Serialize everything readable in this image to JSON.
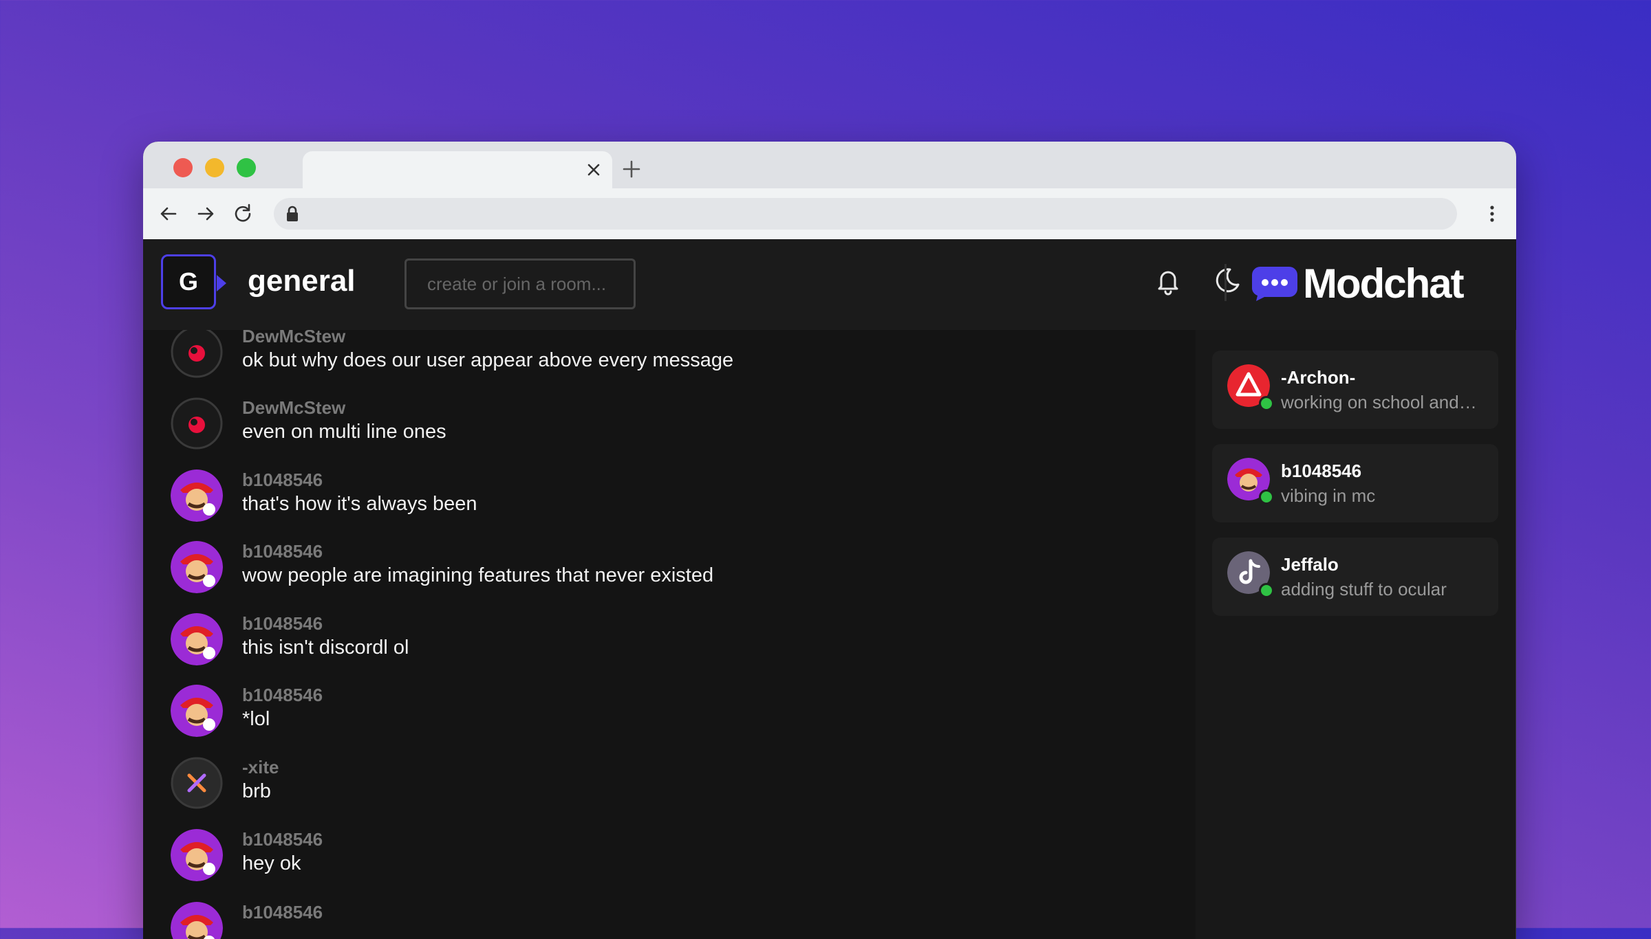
{
  "browser": {
    "tab_title": "",
    "url": ""
  },
  "header": {
    "room_initial": "G",
    "room_name": "general",
    "room_input_placeholder": "create or join a room...",
    "brand_name": "Modchat"
  },
  "messages": [
    {
      "author": "DewMcStew",
      "text": "ok but why does our user appear above every message",
      "avatar": "dewmcstew-avatar"
    },
    {
      "author": "DewMcStew",
      "text": "even on multi line ones",
      "avatar": "dewmcstew-avatar"
    },
    {
      "author": "b1048546",
      "text": "that's how it's always been",
      "avatar": "mario-avatar"
    },
    {
      "author": "b1048546",
      "text": "wow people are imagining features that never existed",
      "avatar": "mario-avatar"
    },
    {
      "author": "b1048546",
      "text": "this isn't discordl ol",
      "avatar": "mario-avatar"
    },
    {
      "author": "b1048546",
      "text": "*lol",
      "avatar": "mario-avatar"
    },
    {
      "author": "-xite",
      "text": "brb",
      "avatar": "xite-avatar"
    },
    {
      "author": "b1048546",
      "text": "hey ok",
      "avatar": "mario-avatar"
    },
    {
      "author": "b1048546",
      "text": "",
      "avatar": "mario-avatar"
    }
  ],
  "online_users": [
    {
      "name": "-Archon-",
      "status": "working on school and…",
      "online": true
    },
    {
      "name": "b1048546",
      "status": "vibing in mc",
      "online": true
    },
    {
      "name": "Jeffalo",
      "status": "adding stuff to ocular",
      "online": true
    }
  ],
  "colors": {
    "accent": "#4d3fe8",
    "online": "#2fc244",
    "app_bg": "#141414"
  }
}
